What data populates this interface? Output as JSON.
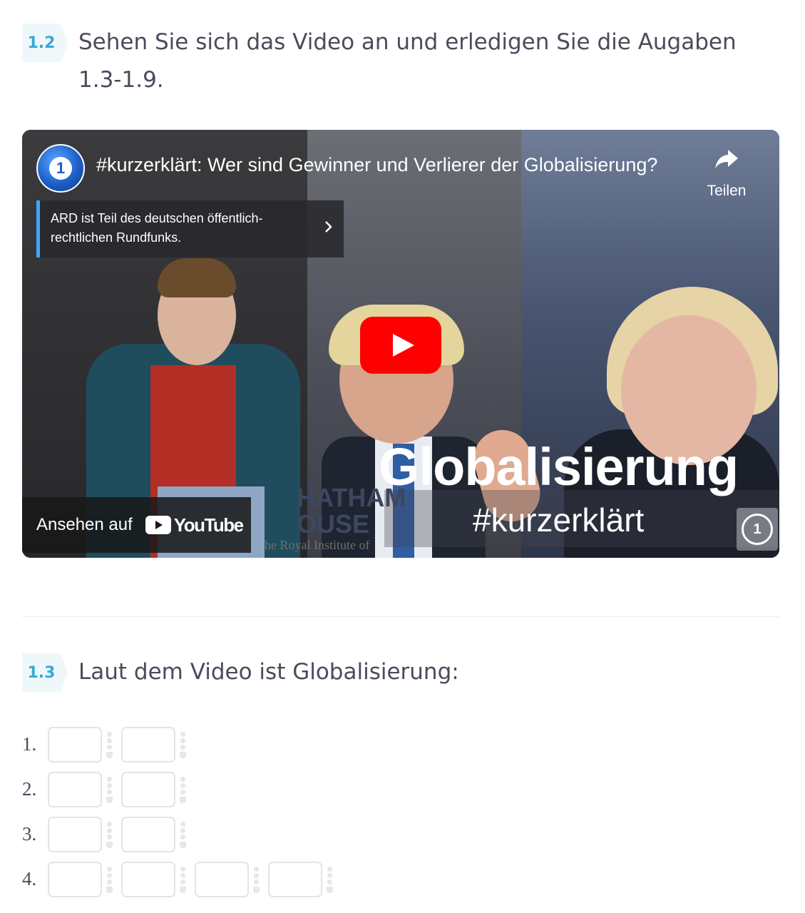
{
  "task_1_2": {
    "number": "1.2",
    "title": "Sehen Sie sich das Video an und erledigen Sie die Augaben 1.3-1.9."
  },
  "video": {
    "title": "#kurzerklärt: Wer sind Gewinner und Verlierer der Globalisierung?",
    "channel_logo": "ard-tagesschau-logo",
    "share_label": "Teilen",
    "info_panel_text": "ARD ist Teil des deutschen öffentlich-rechtlichen Rundfunks.",
    "thumbnail_headline": "Globalisierung",
    "thumbnail_hashtag": "#kurzerklärt",
    "thumbnail_sign_line1": "HATHAM",
    "thumbnail_sign_line2": "OUSE",
    "thumbnail_sign_line3": "he Royal Institute of",
    "watch_on_label": "Ansehen auf",
    "youtube_label": "YouTube",
    "accent_red": "#ff0000",
    "accent_blue": "#3ea6ff"
  },
  "task_1_3": {
    "number": "1.3",
    "title": "Laut dem Video ist Globalisierung:"
  },
  "answers": [
    {
      "label": "1.",
      "slots": 2
    },
    {
      "label": "2.",
      "slots": 2
    },
    {
      "label": "3.",
      "slots": 2
    },
    {
      "label": "4.",
      "slots": 4
    }
  ]
}
